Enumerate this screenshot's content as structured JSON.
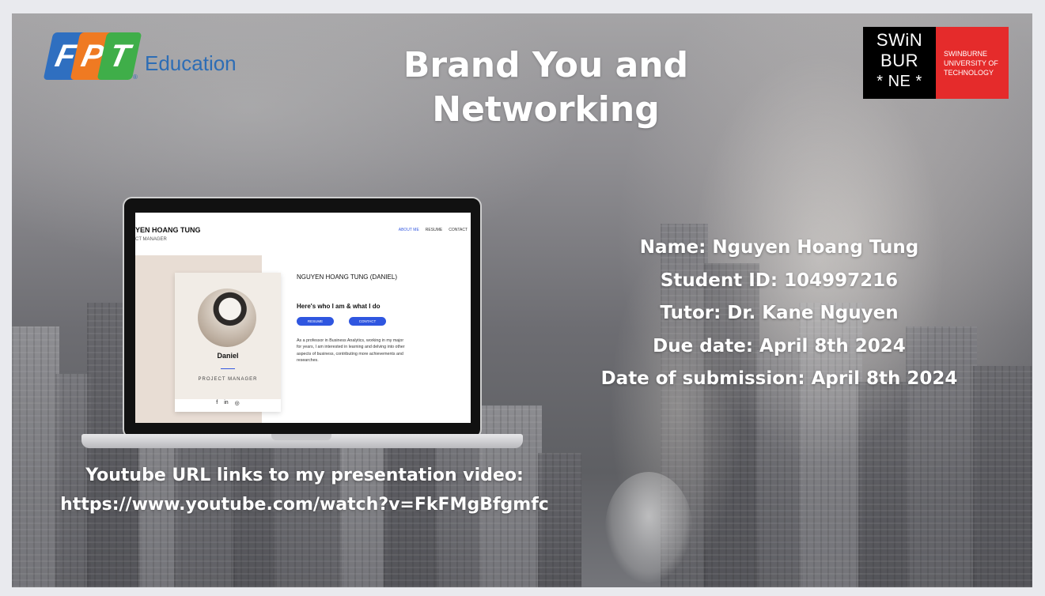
{
  "slide": {
    "title": "Brand You and Networking",
    "fpt_logo": {
      "letters": [
        "F",
        "P",
        "T"
      ],
      "colors": [
        "#2f6fc0",
        "#ef7a22",
        "#3fae49"
      ],
      "suffix": "Education",
      "reg": "®"
    },
    "swinburne_logo": {
      "left_lines": [
        "SWiN",
        "BUR",
        "* NE *"
      ],
      "right_lines": [
        "SWINBURNE",
        "UNIVERSITY OF",
        "TECHNOLOGY"
      ]
    },
    "info": [
      "Name: Nguyen Hoang Tung",
      "Student ID: 104997216",
      "Tutor: Dr. Kane Nguyen",
      "Due date: April 8th 2024",
      "Date of submission: April 8th 2024"
    ],
    "youtube": {
      "label": "Youtube URL links to my presentation video:",
      "url": "https://www.youtube.com/watch?v=FkFMgBfgmfc"
    }
  },
  "laptop_site": {
    "header_name": "YEN HOANG TUNG",
    "header_role": "CT MANAGER",
    "nav": [
      "ABOUT ME",
      "RESUME",
      "CONTACT"
    ],
    "card_name": "Daniel",
    "card_role": "PROJECT MANAGER",
    "card_social": [
      "f",
      "in",
      "◎"
    ],
    "hero_name": "NGUYEN HOANG TUNG (DANIEL)",
    "hero_sub": "Here's who I am & what I do",
    "buttons": [
      "RESUME",
      "CONTACT"
    ],
    "bio": "As a professor in Business Analytics, working in my major for years, I am interested in learning and delving into other aspects of business, contributing more achievements and researches."
  },
  "colors": {
    "accent_blue": "#2f56e0",
    "swinburne_red": "#e52b2b"
  }
}
